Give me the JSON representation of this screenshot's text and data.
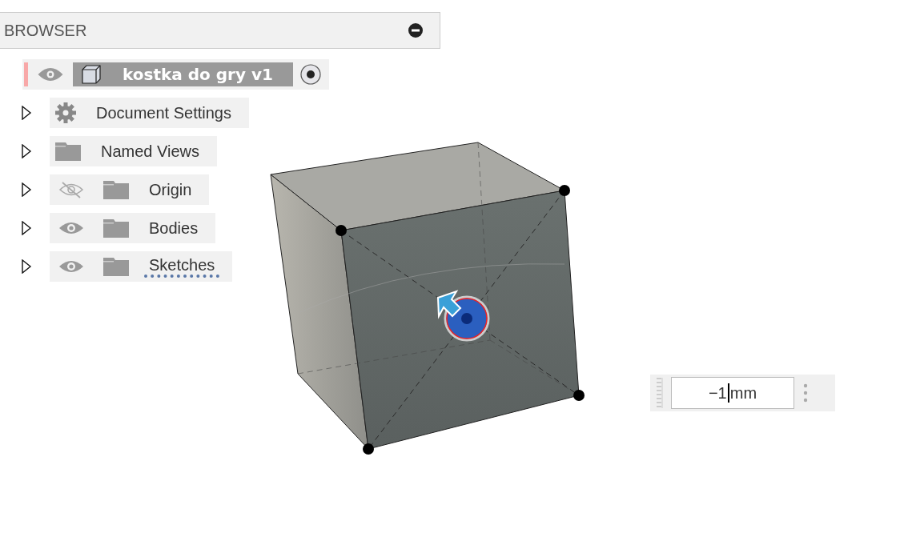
{
  "browser": {
    "title": "BROWSER",
    "root": {
      "label": "kostka do gry v1",
      "visible": true,
      "active": true
    },
    "items": [
      {
        "label": "Document Settings",
        "kind": "gear",
        "expanded": false,
        "dashed_underline": false
      },
      {
        "label": "Named Views",
        "kind": "folder",
        "expanded": false,
        "dashed_underline": false
      },
      {
        "label": "Origin",
        "kind": "eye-folder",
        "visible": false,
        "expanded": false,
        "dashed_underline": false
      },
      {
        "label": "Bodies",
        "kind": "eye-folder",
        "visible": true,
        "expanded": false,
        "dashed_underline": false
      },
      {
        "label": "Sketches",
        "kind": "eye-folder",
        "visible": true,
        "expanded": false,
        "dashed_underline": true
      }
    ]
  },
  "dimension_input": {
    "value": "−1",
    "unit": "mm"
  }
}
